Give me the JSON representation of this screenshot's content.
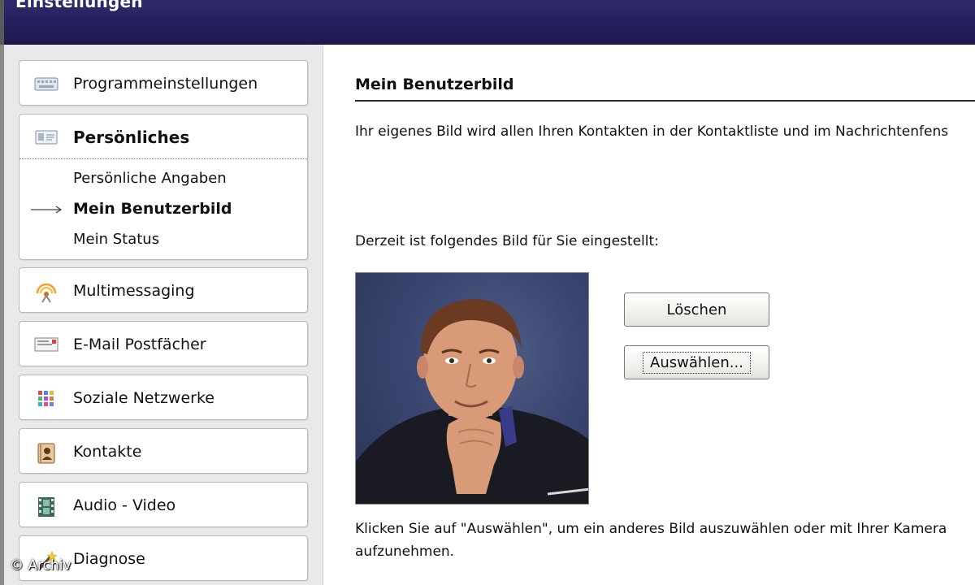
{
  "window": {
    "title": "Einstellungen"
  },
  "sidebar": {
    "items": [
      {
        "label": "Programmeinstellungen",
        "icon": "keyboard-icon"
      },
      {
        "label": "Persönliches",
        "icon": "id-card-icon",
        "subitems": [
          {
            "label": "Persönliche Angaben",
            "active": false
          },
          {
            "label": "Mein Benutzerbild",
            "active": true
          },
          {
            "label": "Mein Status",
            "active": false
          }
        ]
      },
      {
        "label": "Multimessaging",
        "icon": "broadcast-icon"
      },
      {
        "label": "E-Mail Postfächer",
        "icon": "mailbox-icon"
      },
      {
        "label": "Soziale Netzwerke",
        "icon": "grid-icon"
      },
      {
        "label": "Kontakte",
        "icon": "address-book-icon"
      },
      {
        "label": "Audio - Video",
        "icon": "film-icon"
      },
      {
        "label": "Diagnose",
        "icon": "magic-wand-icon"
      }
    ]
  },
  "main": {
    "heading": "Mein Benutzerbild",
    "intro": "Ihr eigenes Bild wird allen Ihren Kontakten in der Kontaktliste und im Nachrichtenfens",
    "current_label": "Derzeit ist folgendes Bild für Sie eingestellt:",
    "delete_button": "Löschen",
    "select_button": "Auswählen...",
    "help_line1": "Klicken Sie auf \"Auswählen\", um ein anderes Bild auszuwählen oder mit Ihrer Kamera",
    "help_line2": "aufzunehmen."
  },
  "watermark": "© Archiv"
}
